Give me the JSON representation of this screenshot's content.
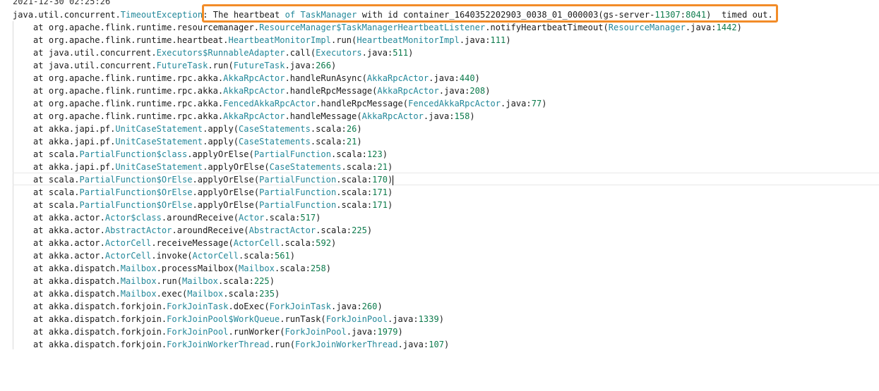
{
  "timestamp": "2021-12-30 02:25:26",
  "exception": {
    "prefix": "java.util.concurrent.",
    "class": "TimeoutException",
    "msg_a": ": The heartbeat ",
    "msg_of": "of",
    "msg_b": " ",
    "tm": "TaskManager",
    "msg_c": " with id container_1640352202903_0038_01_000003(gs-server-",
    "port1": "11307",
    "colon": ":",
    "port2": "8041",
    "msg_d": ")  timed out."
  },
  "stack": [
    {
      "pkg": "org.apache.flink.runtime.resourcemanager.",
      "cls": "ResourceManager$TaskManagerHeartbeatListener",
      "method": ".notifyHeartbeatTimeout(",
      "file": "ResourceManager",
      "ext": ".java:",
      "line": "1442"
    },
    {
      "pkg": "org.apache.flink.runtime.heartbeat.",
      "cls": "HeartbeatMonitorImpl",
      "method": ".run(",
      "file": "HeartbeatMonitorImpl",
      "ext": ".java:",
      "line": "111"
    },
    {
      "pkg": "java.util.concurrent.",
      "cls": "Executors$RunnableAdapter",
      "method": ".call(",
      "file": "Executors",
      "ext": ".java:",
      "line": "511"
    },
    {
      "pkg": "java.util.concurrent.",
      "cls": "FutureTask",
      "method": ".run(",
      "file": "FutureTask",
      "ext": ".java:",
      "line": "266"
    },
    {
      "pkg": "org.apache.flink.runtime.rpc.akka.",
      "cls": "AkkaRpcActor",
      "method": ".handleRunAsync(",
      "file": "AkkaRpcActor",
      "ext": ".java:",
      "line": "440"
    },
    {
      "pkg": "org.apache.flink.runtime.rpc.akka.",
      "cls": "AkkaRpcActor",
      "method": ".handleRpcMessage(",
      "file": "AkkaRpcActor",
      "ext": ".java:",
      "line": "208"
    },
    {
      "pkg": "org.apache.flink.runtime.rpc.akka.",
      "cls": "FencedAkkaRpcActor",
      "method": ".handleRpcMessage(",
      "file": "FencedAkkaRpcActor",
      "ext": ".java:",
      "line": "77"
    },
    {
      "pkg": "org.apache.flink.runtime.rpc.akka.",
      "cls": "AkkaRpcActor",
      "method": ".handleMessage(",
      "file": "AkkaRpcActor",
      "ext": ".java:",
      "line": "158"
    },
    {
      "pkg": "akka.japi.pf.",
      "cls": "UnitCaseStatement",
      "method": ".apply(",
      "file": "CaseStatements",
      "ext": ".scala:",
      "line": "26"
    },
    {
      "pkg": "akka.japi.pf.",
      "cls": "UnitCaseStatement",
      "method": ".apply(",
      "file": "CaseStatements",
      "ext": ".scala:",
      "line": "21"
    },
    {
      "pkg": "scala.",
      "cls": "PartialFunction$class",
      "method": ".applyOrElse(",
      "file": "PartialFunction",
      "ext": ".scala:",
      "line": "123"
    },
    {
      "pkg": "akka.japi.pf.",
      "cls": "UnitCaseStatement",
      "method": ".applyOrElse(",
      "file": "CaseStatements",
      "ext": ".scala:",
      "line": "21"
    },
    {
      "pkg": "scala.",
      "cls": "PartialFunction$OrElse",
      "method": ".applyOrElse(",
      "file": "PartialFunction",
      "ext": ".scala:",
      "line": "170"
    },
    {
      "pkg": "scala.",
      "cls": "PartialFunction$OrElse",
      "method": ".applyOrElse(",
      "file": "PartialFunction",
      "ext": ".scala:",
      "line": "171"
    },
    {
      "pkg": "scala.",
      "cls": "PartialFunction$OrElse",
      "method": ".applyOrElse(",
      "file": "PartialFunction",
      "ext": ".scala:",
      "line": "171"
    },
    {
      "pkg": "akka.actor.",
      "cls": "Actor$class",
      "method": ".aroundReceive(",
      "file": "Actor",
      "ext": ".scala:",
      "line": "517"
    },
    {
      "pkg": "akka.actor.",
      "cls": "AbstractActor",
      "method": ".aroundReceive(",
      "file": "AbstractActor",
      "ext": ".scala:",
      "line": "225"
    },
    {
      "pkg": "akka.actor.",
      "cls": "ActorCell",
      "method": ".receiveMessage(",
      "file": "ActorCell",
      "ext": ".scala:",
      "line": "592"
    },
    {
      "pkg": "akka.actor.",
      "cls": "ActorCell",
      "method": ".invoke(",
      "file": "ActorCell",
      "ext": ".scala:",
      "line": "561"
    },
    {
      "pkg": "akka.dispatch.",
      "cls": "Mailbox",
      "method": ".processMailbox(",
      "file": "Mailbox",
      "ext": ".scala:",
      "line": "258"
    },
    {
      "pkg": "akka.dispatch.",
      "cls": "Mailbox",
      "method": ".run(",
      "file": "Mailbox",
      "ext": ".scala:",
      "line": "225"
    },
    {
      "pkg": "akka.dispatch.",
      "cls": "Mailbox",
      "method": ".exec(",
      "file": "Mailbox",
      "ext": ".scala:",
      "line": "235"
    },
    {
      "pkg": "akka.dispatch.forkjoin.",
      "cls": "ForkJoinTask",
      "method": ".doExec(",
      "file": "ForkJoinTask",
      "ext": ".java:",
      "line": "260"
    },
    {
      "pkg": "akka.dispatch.forkjoin.",
      "cls": "ForkJoinPool$WorkQueue",
      "method": ".runTask(",
      "file": "ForkJoinPool",
      "ext": ".java:",
      "line": "1339"
    },
    {
      "pkg": "akka.dispatch.forkjoin.",
      "cls": "ForkJoinPool",
      "method": ".runWorker(",
      "file": "ForkJoinPool",
      "ext": ".java:",
      "line": "1979"
    },
    {
      "pkg": "akka.dispatch.forkjoin.",
      "cls": "ForkJoinWorkerThread",
      "method": ".run(",
      "file": "ForkJoinWorkerThread",
      "ext": ".java:",
      "line": "107"
    }
  ],
  "at_keyword": "at ",
  "close_paren": ")",
  "colors": {
    "class_name": "#23889a",
    "line_number": "#0b7a4b",
    "callout_border": "#f28c28"
  }
}
